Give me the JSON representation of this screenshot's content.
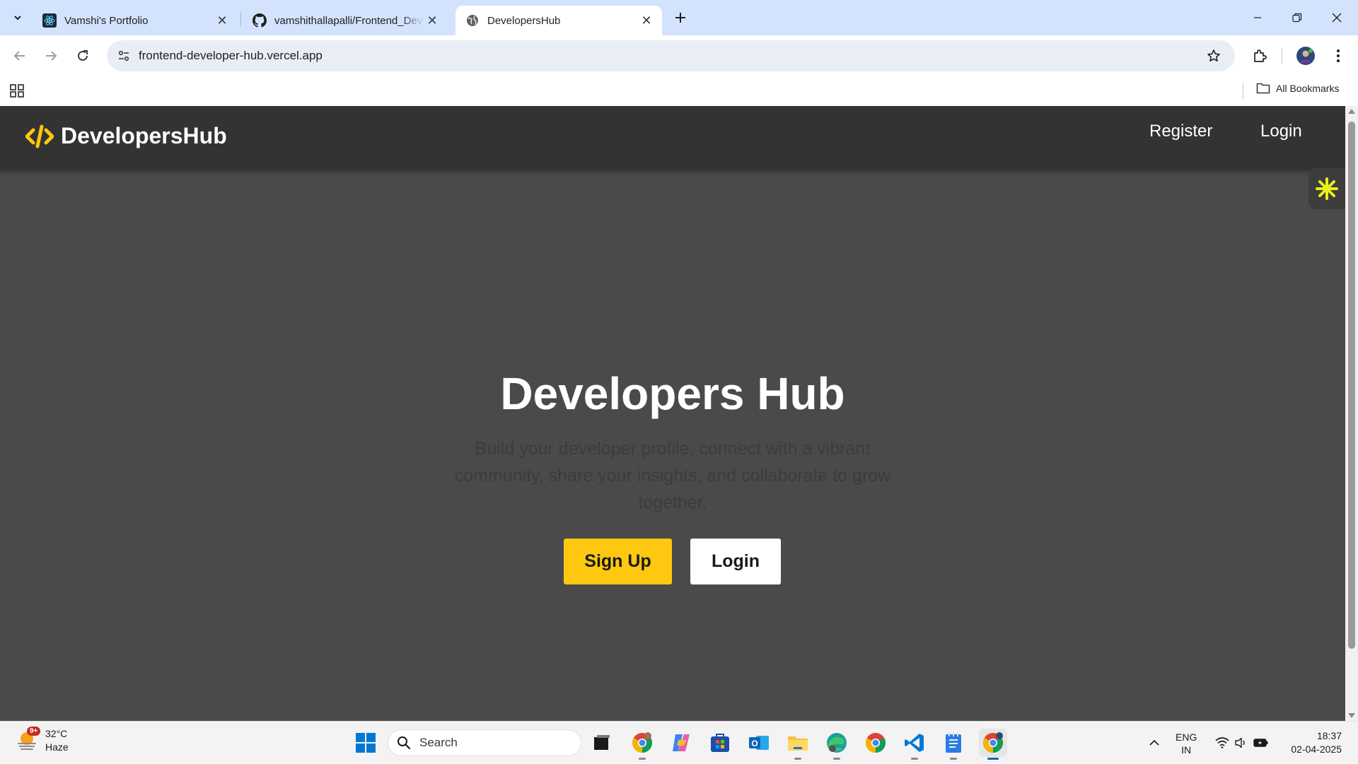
{
  "browser": {
    "tabs": [
      {
        "title": "Vamshi's Portfolio",
        "favicon": "react-icon",
        "active": false
      },
      {
        "title": "vamshithallapalli/Frontend_Dev",
        "favicon": "github-icon",
        "active": false
      },
      {
        "title": "DevelopersHub",
        "favicon": "globe-icon",
        "active": true
      }
    ],
    "url": "frontend-developer-hub.vercel.app",
    "bookmarks_label": "All Bookmarks"
  },
  "site": {
    "brand": "DevelopersHub",
    "nav": {
      "register": "Register",
      "login": "Login"
    },
    "hero": {
      "title": "Developers Hub",
      "subtitle": "Build your developer profile, connect with a vibrant community, share your insights, and collaborate to grow together.",
      "signup_label": "Sign Up",
      "login_label": "Login"
    },
    "colors": {
      "accent": "#fdc80f",
      "navbar": "#333333",
      "background": "#4a4a4a"
    }
  },
  "taskbar": {
    "weather": {
      "badge": "9+",
      "temp": "32°C",
      "condition": "Haze"
    },
    "search_placeholder": "Search",
    "apps": [
      "windows-start-icon",
      "file-explorer-task-icon",
      "chrome-profile-icon",
      "copilot-icon",
      "microsoft-store-icon",
      "outlook-icon",
      "folder-icon",
      "edge-icon",
      "chrome-icon",
      "vscode-icon",
      "notepad-icon",
      "chrome-active-icon"
    ],
    "language": {
      "line1": "ENG",
      "line2": "IN"
    },
    "time": "18:37",
    "date": "02-04-2025"
  }
}
